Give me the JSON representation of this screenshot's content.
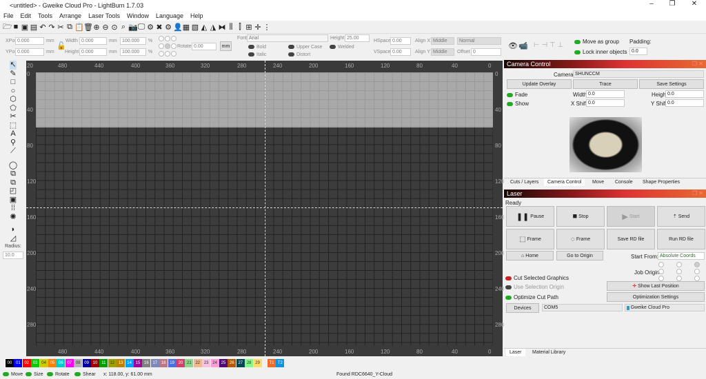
{
  "window": {
    "title": "<untitled> - Gweike Cloud Pro - LightBurn 1.7.03",
    "minimize": "–",
    "maximize": "❐",
    "close": "✕"
  },
  "menu": [
    "File",
    "Edit",
    "Tools",
    "Arrange",
    "Laser Tools",
    "Window",
    "Language",
    "Help"
  ],
  "props": {
    "xpos_label": "XPos",
    "xpos": "0.000",
    "ypos_label": "YPos",
    "ypos": "0.000",
    "unit": "mm",
    "width_label": "Width",
    "width": "0.000",
    "height_label": "Height",
    "height": "0.000",
    "wpct": "100.000",
    "hpct": "100.000",
    "pct": "%",
    "rotate_label": "Rotate",
    "rotate": "0.00",
    "mm_button": "mm",
    "font_label": "Font",
    "font": "Arial",
    "fheight_label": "Height",
    "fheight": "25.00",
    "bold": "Bold",
    "italic": "Italic",
    "upper": "Upper Case",
    "distort": "Distort",
    "welded": "Welded",
    "hspace_label": "HSpace",
    "hspace": "0.00",
    "vspace_label": "VSpace",
    "vspace": "0.00",
    "alignx_label": "Align X",
    "alignx": "Middle",
    "aligny_label": "Align Y",
    "aligny": "Middle",
    "normal": "Normal",
    "offset_label": "Offset",
    "offset": "0",
    "move_group": "Move as group",
    "lock_inner": "Lock inner objects",
    "padding_label": "Padding:",
    "padding": "0.0"
  },
  "left_tools": {
    "radius_label": "Radius:",
    "radius": "10.0"
  },
  "rulers": {
    "top": [
      "480",
      "440",
      "400",
      "360",
      "320",
      "280",
      "240",
      "200",
      "160",
      "120",
      "80",
      "40",
      "0"
    ],
    "left": [
      "0",
      "40",
      "80",
      "120",
      "160",
      "200",
      "240",
      "280"
    ],
    "corner": "20"
  },
  "camera": {
    "title": "Camera Control",
    "camera_label": "Camera:",
    "camera": "SHUNCCM",
    "update": "Update Overlay",
    "trace": "Trace",
    "save": "Save Settings",
    "fade": "Fade",
    "show": "Show",
    "width_label": "Width",
    "width": "0.0",
    "height_label": "Height",
    "height": "0.0",
    "xshift_label": "X Shift",
    "xshift": "0.0",
    "yshift_label": "Y Shift",
    "yshift": "0.0"
  },
  "dock_tabs": [
    "Cuts / Layers",
    "Camera Control",
    "Move",
    "Console",
    "Shape Properties"
  ],
  "laser": {
    "title": "Laser",
    "status": "Ready",
    "pause": "Pause",
    "stop": "Stop",
    "start": "Start",
    "send": "Send",
    "frame1": "Frame",
    "frame2": "Frame",
    "save_rd": "Save RD file",
    "run_rd": "Run RD file",
    "home": "Home",
    "go_origin": "Go to Origin",
    "start_from_label": "Start From:",
    "start_from": "Absolute Coords",
    "job_origin": "Job Origin",
    "cut_selected": "Cut Selected Graphics",
    "use_selection": "Use Selection Origin",
    "optimize": "Optimize Cut Path",
    "show_last": "Show Last Position",
    "opt_settings": "Optimization Settings",
    "devices": "Devices",
    "port": "COM5",
    "device": "Gweike Cloud Pro"
  },
  "bottom_tabs": [
    "Laser",
    "Material Library"
  ],
  "palette": [
    {
      "l": "00",
      "c": "#000000"
    },
    {
      "l": "01",
      "c": "#0000ff"
    },
    {
      "l": "02",
      "c": "#ff0000"
    },
    {
      "l": "03",
      "c": "#00cc00"
    },
    {
      "l": "04",
      "c": "#cccc00"
    },
    {
      "l": "05",
      "c": "#ff8000"
    },
    {
      "l": "06",
      "c": "#00cccc"
    },
    {
      "l": "07",
      "c": "#ff00ff"
    },
    {
      "l": "08",
      "c": "#b4b4b4"
    },
    {
      "l": "09",
      "c": "#0000a0"
    },
    {
      "l": "10",
      "c": "#a00000"
    },
    {
      "l": "11",
      "c": "#00a000"
    },
    {
      "l": "12",
      "c": "#a0a000"
    },
    {
      "l": "13",
      "c": "#c08000"
    },
    {
      "l": "14",
      "c": "#00a0ff"
    },
    {
      "l": "15",
      "c": "#a000a0"
    },
    {
      "l": "16",
      "c": "#808080"
    },
    {
      "l": "17",
      "c": "#7d87b9"
    },
    {
      "l": "18",
      "c": "#bb7784"
    },
    {
      "l": "19",
      "c": "#4a6fe3"
    },
    {
      "l": "20",
      "c": "#d33f6a"
    },
    {
      "l": "21",
      "c": "#8cd78c"
    },
    {
      "l": "22",
      "c": "#f0b98d"
    },
    {
      "l": "23",
      "c": "#f6c4e1"
    },
    {
      "l": "24",
      "c": "#fa9ed4"
    },
    {
      "l": "25",
      "c": "#500a78"
    },
    {
      "l": "26",
      "c": "#b45a00"
    },
    {
      "l": "27",
      "c": "#004754"
    },
    {
      "l": "28",
      "c": "#86fa88"
    },
    {
      "l": "29",
      "c": "#ffdb66"
    },
    {
      "l": "T1",
      "c": "#f36926"
    },
    {
      "l": "T2",
      "c": "#0c94e0"
    }
  ],
  "status": {
    "move": "Move",
    "size": "Size",
    "rotate": "Rotate",
    "shear": "Shear",
    "coords": "x: 118.00, y: 61.00 mm",
    "device_msg": "Found RDC6640_Y-Cloud"
  }
}
